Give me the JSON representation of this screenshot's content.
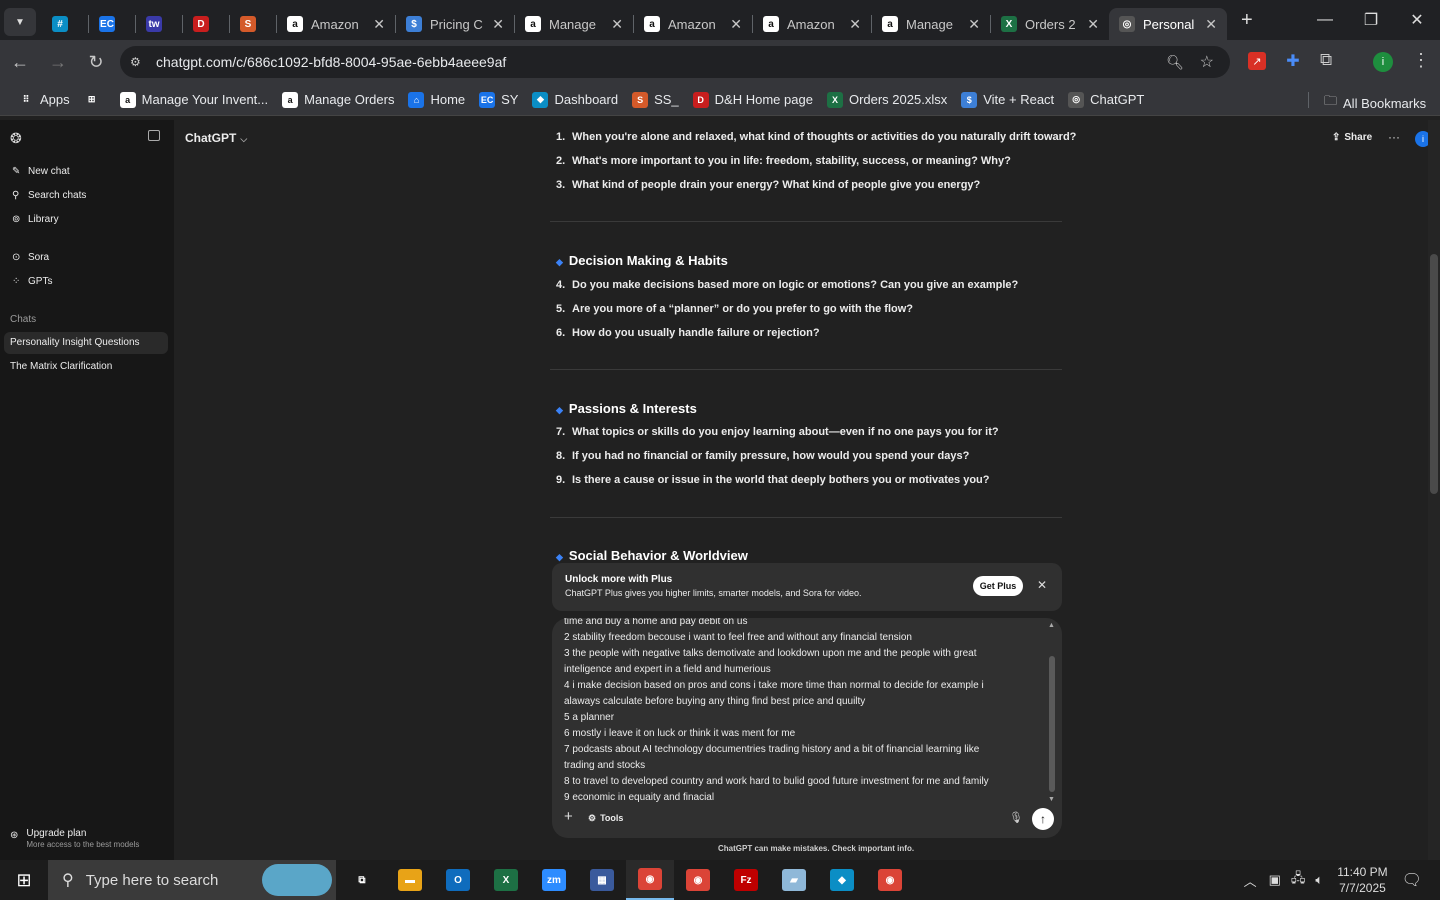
{
  "tabs": [
    {
      "label": "",
      "fav": "#",
      "favbg": "#0b8ec5",
      "icon": "diamond-icon"
    },
    {
      "label": "",
      "fav": "EC",
      "favbg": "#1a73e8",
      "icon": "ec-icon"
    },
    {
      "label": "",
      "fav": "tw",
      "favbg": "#3a3aa8",
      "icon": "tw-icon"
    },
    {
      "label": "",
      "fav": "D",
      "favbg": "#c81e1e",
      "icon": "dh-icon"
    },
    {
      "label": "",
      "fav": "S",
      "favbg": "#d45a2a",
      "icon": "stack-icon"
    },
    {
      "label": "Amazon",
      "fav": "a",
      "favbg": "#fff",
      "icon": "amazon-icon"
    },
    {
      "label": "Pricing C",
      "fav": "$",
      "favbg": "#3d7fd6",
      "icon": "dollar-icon"
    },
    {
      "label": "Manage",
      "fav": "a",
      "favbg": "#fff",
      "icon": "amazon-icon"
    },
    {
      "label": "Amazon",
      "fav": "a",
      "favbg": "#fff",
      "icon": "amazon-icon"
    },
    {
      "label": "Amazon",
      "fav": "a",
      "favbg": "#fff",
      "icon": "amazon-icon"
    },
    {
      "label": "Manage",
      "fav": "a",
      "favbg": "#fff",
      "icon": "amazon-icon"
    },
    {
      "label": "Orders 2",
      "fav": "X",
      "favbg": "#1d7044",
      "icon": "excel-icon"
    },
    {
      "label": "Personal",
      "fav": "◎",
      "favbg": "#555",
      "icon": "chatgpt-icon",
      "active": true
    }
  ],
  "url": "chatgpt.com/c/686c1092-bfd8-8004-95ae-6ebb4aeee9af",
  "bookmarks": [
    {
      "label": "Apps",
      "icon": "apps-icon",
      "bg": "#35363a",
      "g": "⠿"
    },
    {
      "label": "",
      "icon": "grid-icon",
      "bg": "#35363a",
      "g": "⊞"
    },
    {
      "label": "Manage Your Invent...",
      "icon": "amazon-icon",
      "bg": "#fff",
      "g": "a"
    },
    {
      "label": "Manage Orders",
      "icon": "amazon-icon",
      "bg": "#fff",
      "g": "a"
    },
    {
      "label": "Home",
      "icon": "home-icon",
      "bg": "#1a73e8",
      "g": "⌂"
    },
    {
      "label": "SY",
      "icon": "ec-icon",
      "bg": "#1a73e8",
      "g": "EC"
    },
    {
      "label": "Dashboard",
      "icon": "diamond-icon",
      "bg": "#0b8ec5",
      "g": "◆"
    },
    {
      "label": "SS_",
      "icon": "stack-icon",
      "bg": "#d45a2a",
      "g": "S"
    },
    {
      "label": "D&H Home page",
      "icon": "dh-icon",
      "bg": "#c81e1e",
      "g": "D"
    },
    {
      "label": "Orders 2025.xlsx",
      "icon": "excel-icon",
      "bg": "#1d7044",
      "g": "X"
    },
    {
      "label": "Vite + React",
      "icon": "dollar-icon",
      "bg": "#3d7fd6",
      "g": "$"
    },
    {
      "label": "ChatGPT",
      "icon": "chatgpt-icon",
      "bg": "#555",
      "g": "◎"
    }
  ],
  "all_bookmarks": "All Bookmarks",
  "sidebar": {
    "new_chat": "New chat",
    "search": "Search chats",
    "library": "Library",
    "sora": "Sora",
    "gpts": "GPTs",
    "chats_label": "Chats",
    "chats": [
      "Personality Insight Questions",
      "The Matrix Clarification"
    ],
    "upgrade": "Upgrade plan",
    "upgrade_sub": "More access to the best models"
  },
  "header": {
    "title": "ChatGPT",
    "share": "Share"
  },
  "sections": [
    {
      "heading": "",
      "items": [
        {
          "n": "1.",
          "t": "When you're alone and relaxed, what kind of thoughts or activities do you naturally drift toward?"
        },
        {
          "n": "2.",
          "t": "What's more important to you in life: freedom, stability, success, or meaning? Why?"
        },
        {
          "n": "3.",
          "t": "What kind of people drain your energy? What kind of people give you energy?"
        }
      ]
    },
    {
      "heading": "Decision Making & Habits",
      "items": [
        {
          "n": "4.",
          "t": "Do you make decisions based more on logic or emotions? Can you give an example?"
        },
        {
          "n": "5.",
          "t": "Are you more of a “planner” or do you prefer to go with the flow?"
        },
        {
          "n": "6.",
          "t": "How do you usually handle failure or rejection?"
        }
      ]
    },
    {
      "heading": "Passions & Interests",
      "items": [
        {
          "n": "7.",
          "t": "What topics or skills do you enjoy learning about—even if no one pays you for it?"
        },
        {
          "n": "8.",
          "t": "If you had no financial or family pressure, how would you spend your days?"
        },
        {
          "n": "9.",
          "t": "Is there a cause or issue in the world that deeply bothers you or motivates you?"
        }
      ]
    },
    {
      "heading": "Social Behavior & Worldview",
      "items": []
    }
  ],
  "promo": {
    "title": "Unlock more with Plus",
    "body": "ChatGPT Plus gives you higher limits, smarter models, and Sora for video.",
    "button": "Get Plus"
  },
  "composer": {
    "lines": [
      "time and buy a home and pay debit on us",
      "2 stability freedom  becouse  i want to  feel free and without any financial tension",
      "3  the people with negative talks  demotivate and lookdown upon me  and the people with great",
      "inteligence and expert in a field and humerious",
      "4   i make decision based on pros and cons i take more time than normal to decide  for example i",
      "alaways calculate before buying any thing find best price and quuilty",
      "5 a planner",
      "6  mostly i leave it on luck or think it was ment for me",
      "7   podcasts about  AI  technology  documentries  trading   history and a bit of financial learning like",
      "trading and stocks",
      "8   to travel to developed country and work hard to bulid good future investment for me and family",
      "9   economic in equaity and finacial"
    ],
    "tools": "Tools"
  },
  "disclaimer": "ChatGPT can make mistakes. Check important info.",
  "taskbar": {
    "search": "Type here to search",
    "time": "11:40 PM",
    "date": "7/7/2025",
    "apps": [
      {
        "icon": "task-view-icon",
        "bg": "transparent",
        "g": "⧉"
      },
      {
        "icon": "file-explorer-icon",
        "bg": "#e8a317",
        "g": "▬"
      },
      {
        "icon": "outlook-icon",
        "bg": "#0f6cbd",
        "g": "O"
      },
      {
        "icon": "excel-icon",
        "bg": "#1d7044",
        "g": "X"
      },
      {
        "icon": "zoom-icon",
        "bg": "#2d8cff",
        "g": "zm"
      },
      {
        "icon": "calculator-icon",
        "bg": "#3a5a9c",
        "g": "▦"
      },
      {
        "icon": "chrome-icon",
        "bg": "#db4437",
        "g": "◉",
        "active": true
      },
      {
        "icon": "chrome-icon",
        "bg": "#db4437",
        "g": "◉"
      },
      {
        "icon": "filezilla-icon",
        "bg": "#bf0000",
        "g": "Fz"
      },
      {
        "icon": "app-icon",
        "bg": "#8fb8d8",
        "g": "▰"
      },
      {
        "icon": "diamond-icon",
        "bg": "#0b8ec5",
        "g": "◆"
      },
      {
        "icon": "chrome-profile-icon",
        "bg": "#db4437",
        "g": "◉"
      }
    ]
  }
}
